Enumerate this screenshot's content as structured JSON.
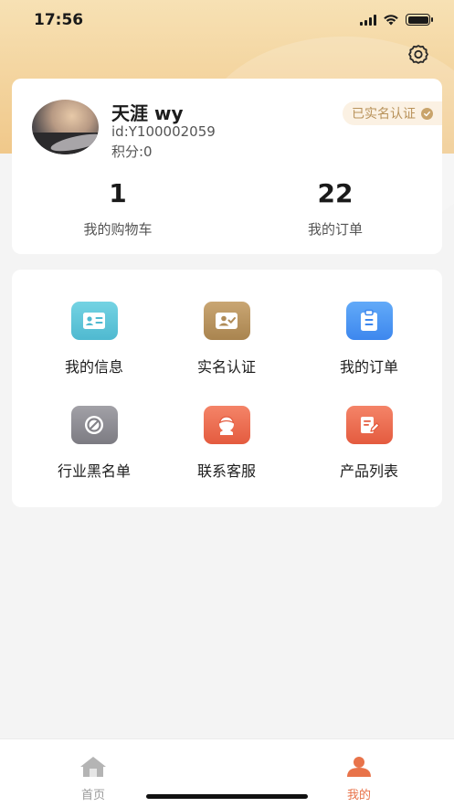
{
  "status_bar": {
    "time": "17:56"
  },
  "profile": {
    "name": "天涯 wy",
    "id": "id:Y100002059",
    "points": "积分:0",
    "verify_badge": "已实名认证"
  },
  "stats": {
    "cart": {
      "value": "1",
      "label": "我的购物车"
    },
    "orders": {
      "value": "22",
      "label": "我的订单"
    }
  },
  "menu": {
    "items": [
      {
        "label": "我的信息",
        "icon": "id-card-icon",
        "color": "#5fc7da"
      },
      {
        "label": "实名认证",
        "icon": "verified-user-icon",
        "color": "#b89561"
      },
      {
        "label": "我的订单",
        "icon": "clipboard-icon",
        "color": "#4f9af5"
      },
      {
        "label": "行业黑名单",
        "icon": "ban-icon",
        "color": "#8b8a90"
      },
      {
        "label": "联系客服",
        "icon": "customer-service-icon",
        "color": "#ee6a4e"
      },
      {
        "label": "产品列表",
        "icon": "edit-list-icon",
        "color": "#ee6a4e"
      }
    ]
  },
  "tab_bar": {
    "home": "首页",
    "mine": "我的"
  },
  "colors": {
    "accent": "#e8734a",
    "inactive": "#9a9a9a",
    "gold": "#b8925a"
  }
}
